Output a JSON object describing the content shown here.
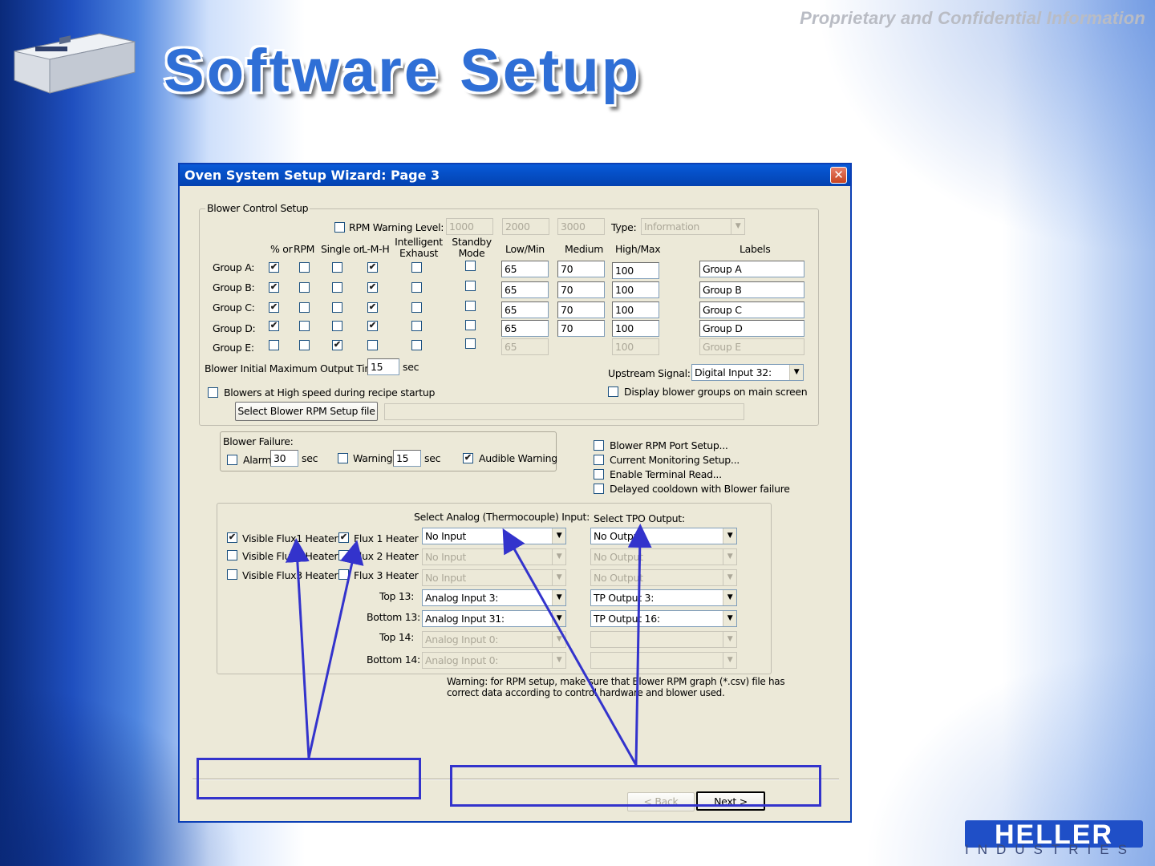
{
  "slide": {
    "title": "Software Setup",
    "confidential": "Proprietary and Confidential Information",
    "logo_subtext": "INDUSTRIES"
  },
  "dialog": {
    "title": "Oven System Setup Wizard: Page 3",
    "blower": {
      "legend": "Blower Control Setup",
      "rpm_warning_label": "RPM Warning Level:",
      "rpm_levels": [
        "1000",
        "2000",
        "3000"
      ],
      "type_label": "Type:",
      "type_value": "Information",
      "headers": {
        "pct": "% or",
        "rpm": "RPM",
        "single": "Single or",
        "lmh": "L-M-H",
        "exhaust_1": "Intelligent",
        "exhaust_2": "Exhaust",
        "standby_1": "Standby",
        "standby_2": "Mode",
        "low": "Low/Min",
        "medium": "Medium",
        "high": "High/Max",
        "labels": "Labels"
      },
      "groups": [
        {
          "label": "Group A:",
          "low": "65",
          "medium": "70",
          "high": "100",
          "name": "Group A"
        },
        {
          "label": "Group B:",
          "low": "65",
          "medium": "70",
          "high": "100",
          "name": "Group B"
        },
        {
          "label": "Group C:",
          "low": "65",
          "medium": "70",
          "high": "100",
          "name": "Group C"
        },
        {
          "label": "Group D:",
          "low": "65",
          "medium": "70",
          "high": "100",
          "name": "Group D"
        },
        {
          "label": "Group E:",
          "low": "65",
          "medium": "",
          "high": "100",
          "name": "Group E"
        }
      ],
      "initial_time_label": "Blower Initial Maximum Output Time:",
      "initial_time_value": "15",
      "sec": "sec",
      "upstream_label": "Upstream Signal:",
      "upstream_value": "Digital Input  32:",
      "high_speed_label": "Blowers at High speed during recipe startup",
      "display_groups_label": "Display blower groups on main screen",
      "select_file_button": "Select Blower RPM Setup file"
    },
    "failure": {
      "legend": "Blower Failure:",
      "alarm_label": "Alarm",
      "alarm_value": "30",
      "warning_label": "Warning",
      "warning_value": "15",
      "audible_label": "Audible Warning",
      "sec": "sec"
    },
    "options": [
      "Blower RPM Port Setup...",
      "Current Monitoring Setup...",
      "Enable Terminal Read...",
      "Delayed cooldown with Blower failure"
    ],
    "flux": {
      "analog_header": "Select Analog (Thermocouple) Input:",
      "tpo_header": "Select TPO Output:",
      "visible": [
        "Visible Flux1 Heater",
        "Visible Flux2 Heater",
        "Visible Flux3 Heater"
      ],
      "heaters": [
        "Flux 1 Heater",
        "Flux 2 Heater",
        "Flux 3 Heater"
      ],
      "analog_values": [
        "No Input",
        "No Input",
        "No Input",
        "Analog Input 3:",
        "Analog Input 31:",
        "Analog Input 0:",
        "Analog Input 0:"
      ],
      "tpo_values": [
        "No Output",
        "No Output",
        "No Output",
        "TP Output 3:",
        "TP Output 16:",
        "",
        ""
      ],
      "row_labels": [
        "Top 13:",
        "Bottom 13:",
        "Top 14:",
        "Bottom 14:"
      ]
    },
    "warning_text_1": "Warning: for RPM setup, make sure that Blower RPM graph (*.csv) file has",
    "warning_text_2": "correct data according to control hardware and blower used.",
    "back_button": "< Back",
    "next_button": "Next >"
  }
}
